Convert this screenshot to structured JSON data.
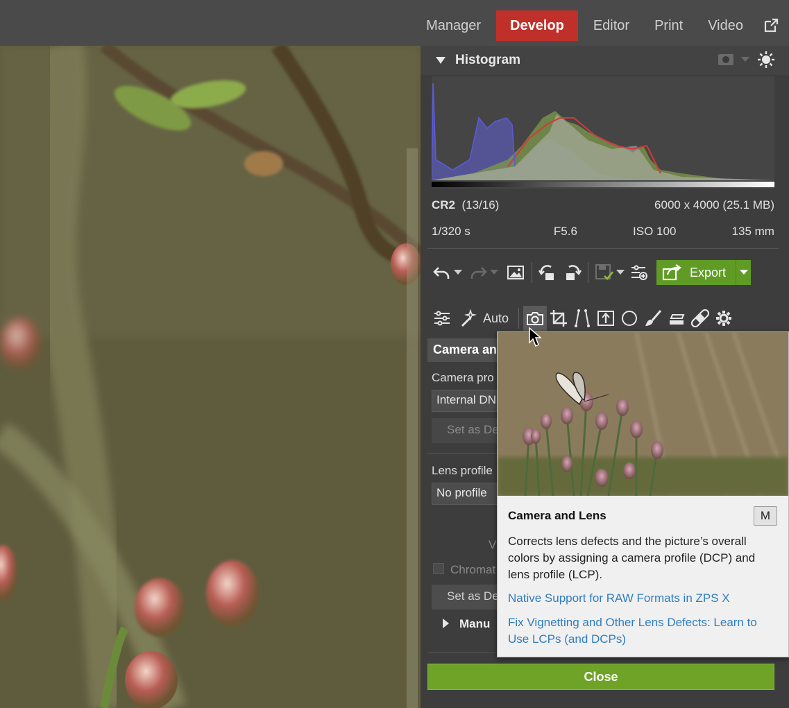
{
  "nav": {
    "tabs": [
      {
        "label": "Manager"
      },
      {
        "label": "Develop"
      },
      {
        "label": "Editor"
      },
      {
        "label": "Print"
      },
      {
        "label": "Video"
      }
    ],
    "active_tab": "Develop",
    "external_icon": "external-window-icon"
  },
  "histogram": {
    "title": "Histogram",
    "format": "CR2",
    "index": "(13/16)",
    "dimensions": "6000 x 4000 (25.1 MB)",
    "shutter": "1/320 s",
    "aperture": "F5.6",
    "iso": "ISO 100",
    "focal_length": "135 mm"
  },
  "toolbar": {
    "export_label": "Export",
    "auto_label": "Auto"
  },
  "section": {
    "title": "Camera an",
    "camera_profile_label": "Camera pro",
    "camera_profile_value": "Internal DN",
    "set_default_label": "Set as De",
    "lens_profile_label": "Lens profile",
    "lens_profile_value": "No profile",
    "vignette_label": "V",
    "chromatic_label": "Chromat",
    "set_default_label_2": "Set as De",
    "manual_label": "Manu"
  },
  "close_label": "Close",
  "tooltip": {
    "title": "Camera and Lens",
    "shortcut": "M",
    "description": "Corrects lens defects and the picture’s overall colors by assigning a camera profile (DCP) and lens profile (LCP).",
    "link_1": "Native Support for RAW Formats in ZPS X",
    "link_2": "Fix Vignetting and Other Lens Defects: Learn to Use LCPs (and DCPs)"
  },
  "colors": {
    "accent_red": "#c0302a",
    "accent_green": "#6fa327",
    "link_blue": "#2f7cbf"
  }
}
